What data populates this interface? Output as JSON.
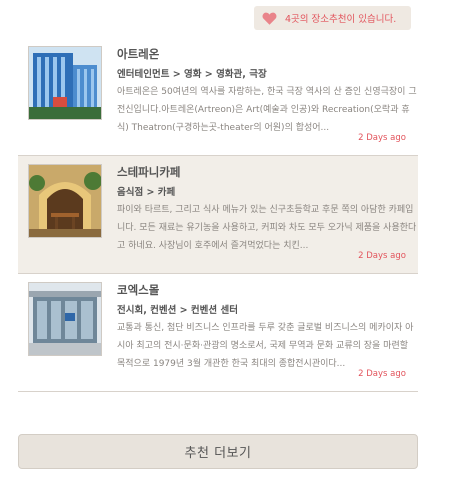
{
  "badge": {
    "text": "4곳의 장소추천이 있습니다."
  },
  "items": [
    {
      "title": "아트레온",
      "category": "엔터테인먼트 > 영화 > 영화관, 극장",
      "description": "아트레온은 50여년의 역사를 자랑하는, 한국 극장 역사의 산 증인 신영극장이 그 전신입니다.아트레온(Artreon)은 Art(예술과 인공)와 Recreation(오락과 휴식) Theatron(구경하는곳-theater의 어원)의 합성어...",
      "date": "2 Days ago"
    },
    {
      "title": "스테파니카페",
      "category": "음식점 > 카페",
      "description": "파이와 타르트, 그리고 식사 메뉴가 있는 신구초등학교 후문 쪽의 아담한 카페입니다. 모든 재료는 유기농을 사용하고, 커피와 차도 모두 오가닉 제품을 사용한다고 하네요. 사장님이 호주에서 즐겨먹었다는 치킨...",
      "date": "2 Days ago"
    },
    {
      "title": "코엑스몰",
      "category": "전시회, 컨벤션 > 컨벤션 센터",
      "description": "교통과 통신, 첨단 비즈니스 인프라를 두루 갖춘 글로벌 비즈니스의 메카이자 아시아 최고의 전시·문화·관광의 명소로서, 국제 무역과 문화 교류의 장을 마련할 목적으로 1979년 3월 개관한 한국 최대의 종합전시관이다...",
      "date": "2 Days ago"
    }
  ],
  "more_button": {
    "label": "추천 더보기"
  }
}
